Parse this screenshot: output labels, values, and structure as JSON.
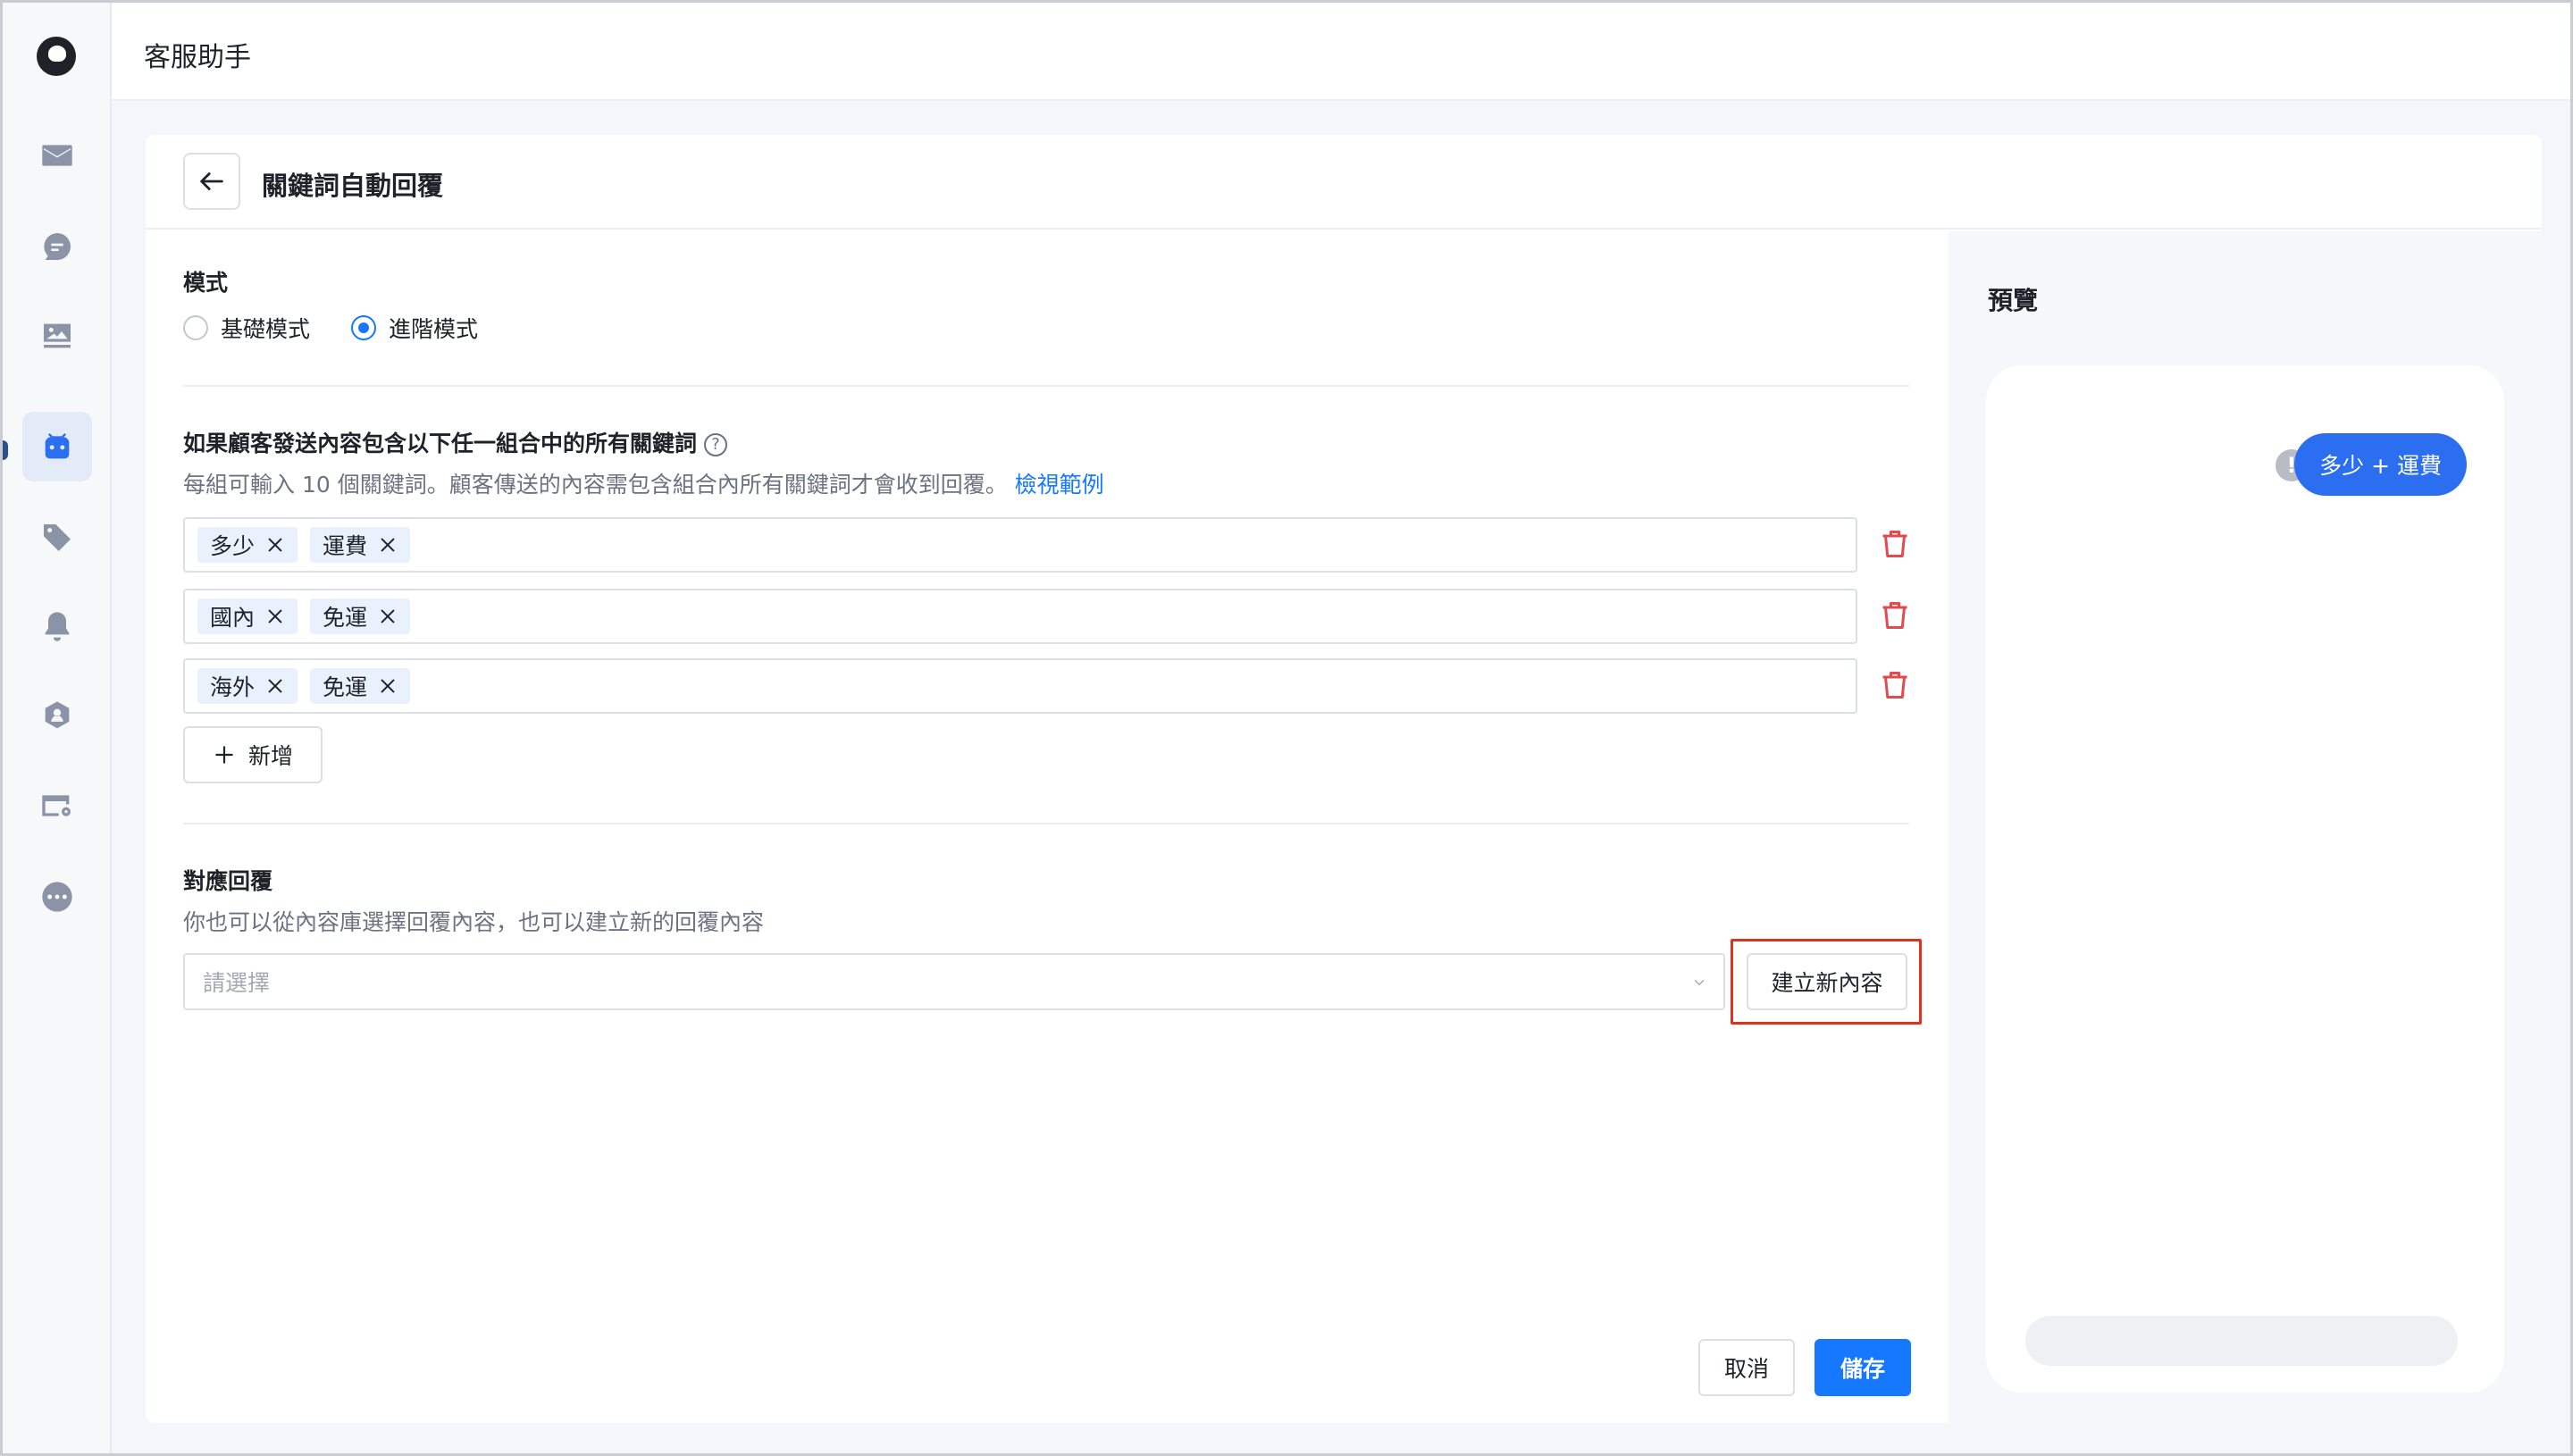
{
  "app": {
    "title": "客服助手"
  },
  "sidebar": {
    "items": [
      {
        "icon": "mail-icon"
      },
      {
        "icon": "chat-icon"
      },
      {
        "icon": "image-icon"
      },
      {
        "icon": "robot-icon",
        "active": true
      },
      {
        "icon": "tag-icon"
      },
      {
        "icon": "bell-icon"
      },
      {
        "icon": "user-shield-icon"
      },
      {
        "icon": "card-settings-icon"
      },
      {
        "icon": "more-icon"
      }
    ]
  },
  "page": {
    "title": "關鍵詞自動回覆"
  },
  "mode": {
    "label": "模式",
    "options": [
      {
        "label": "基礎模式",
        "checked": false
      },
      {
        "label": "進階模式",
        "checked": true
      }
    ]
  },
  "keywords": {
    "label": "如果顧客發送內容包含以下任一組合中的所有關鍵詞",
    "hint": "每組可輸入 10 個關鍵詞。顧客傳送的內容需包含組合內所有關鍵詞才會收到回覆。",
    "hint_link": "檢視範例",
    "groups": [
      [
        "多少",
        "運費"
      ],
      [
        "國內",
        "免運"
      ],
      [
        "海外",
        "免運"
      ]
    ],
    "add_label": "新增"
  },
  "reply": {
    "label": "對應回覆",
    "hint": "你也可以從內容庫選擇回覆內容，也可以建立新的回覆內容",
    "select_placeholder": "請選擇",
    "new_content_label": "建立新內容"
  },
  "actions": {
    "cancel_label": "取消",
    "save_label": "儲存"
  },
  "preview": {
    "title": "預覽",
    "bubble_text": "多少 + 運費"
  },
  "colors": {
    "primary": "#1677ff",
    "bubble": "#2b6ef0",
    "danger": "#e5484d",
    "highlight": "#e0301e"
  }
}
